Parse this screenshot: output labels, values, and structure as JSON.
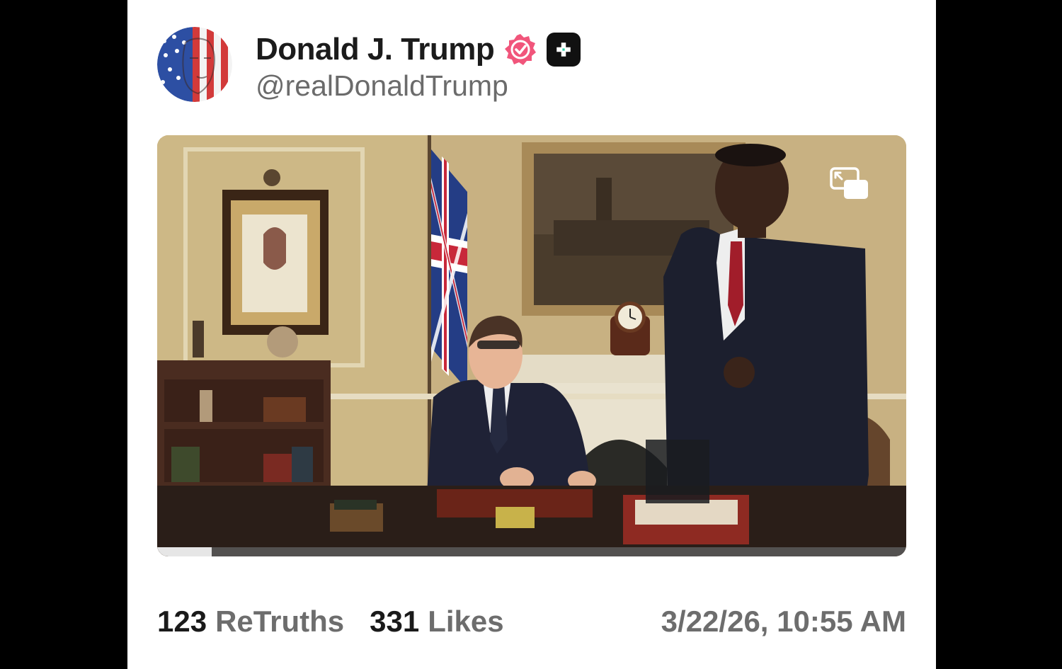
{
  "post": {
    "author": {
      "display_name": "Donald J. Trump",
      "handle": "@realDonaldTrump",
      "avatar_icon": "flag-face-avatar",
      "verified_icon": "verified-badge-icon",
      "verified_color": "#f1557b",
      "plus_icon": "truth-plus-icon"
    },
    "media": {
      "type": "video",
      "pip_icon": "picture-in-picture-icon",
      "progress_fraction": 0.073
    },
    "stats": {
      "retruths_count": "123",
      "retruths_label": "ReTruths",
      "likes_count": "331",
      "likes_label": "Likes"
    },
    "timestamp": "3/22/26, 10:55 AM"
  }
}
